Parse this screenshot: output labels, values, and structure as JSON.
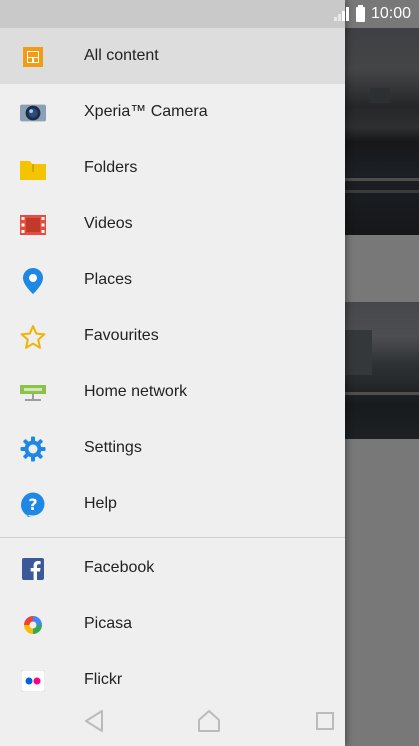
{
  "status_bar": {
    "time": "10:00",
    "signal": "signal-icon",
    "battery": "battery-icon"
  },
  "drawer": {
    "items": [
      {
        "label": "All content",
        "icon": "all-content-icon",
        "selected": true
      },
      {
        "label": "Xperia™ Camera",
        "icon": "camera-icon",
        "selected": false
      },
      {
        "label": "Folders",
        "icon": "folder-icon",
        "selected": false
      },
      {
        "label": "Videos",
        "icon": "videos-icon",
        "selected": false
      },
      {
        "label": "Places",
        "icon": "places-pin-icon",
        "selected": false
      },
      {
        "label": "Favourites",
        "icon": "star-icon",
        "selected": false
      },
      {
        "label": "Home network",
        "icon": "home-network-icon",
        "selected": false
      },
      {
        "label": "Settings",
        "icon": "gear-icon",
        "selected": false
      },
      {
        "label": "Help",
        "icon": "help-icon",
        "selected": false
      }
    ],
    "services": [
      {
        "label": "Facebook",
        "icon": "facebook-icon"
      },
      {
        "label": "Picasa",
        "icon": "picasa-icon"
      },
      {
        "label": "Flickr",
        "icon": "flickr-icon"
      }
    ]
  },
  "nav_bar": {
    "back": "back-icon",
    "home": "home-icon",
    "recents": "recents-icon"
  },
  "colors": {
    "drawer_bg": "#efefef",
    "selected_bg": "#dddddd",
    "accent_orange": "#f39c12",
    "accent_blue": "#2196f3"
  }
}
